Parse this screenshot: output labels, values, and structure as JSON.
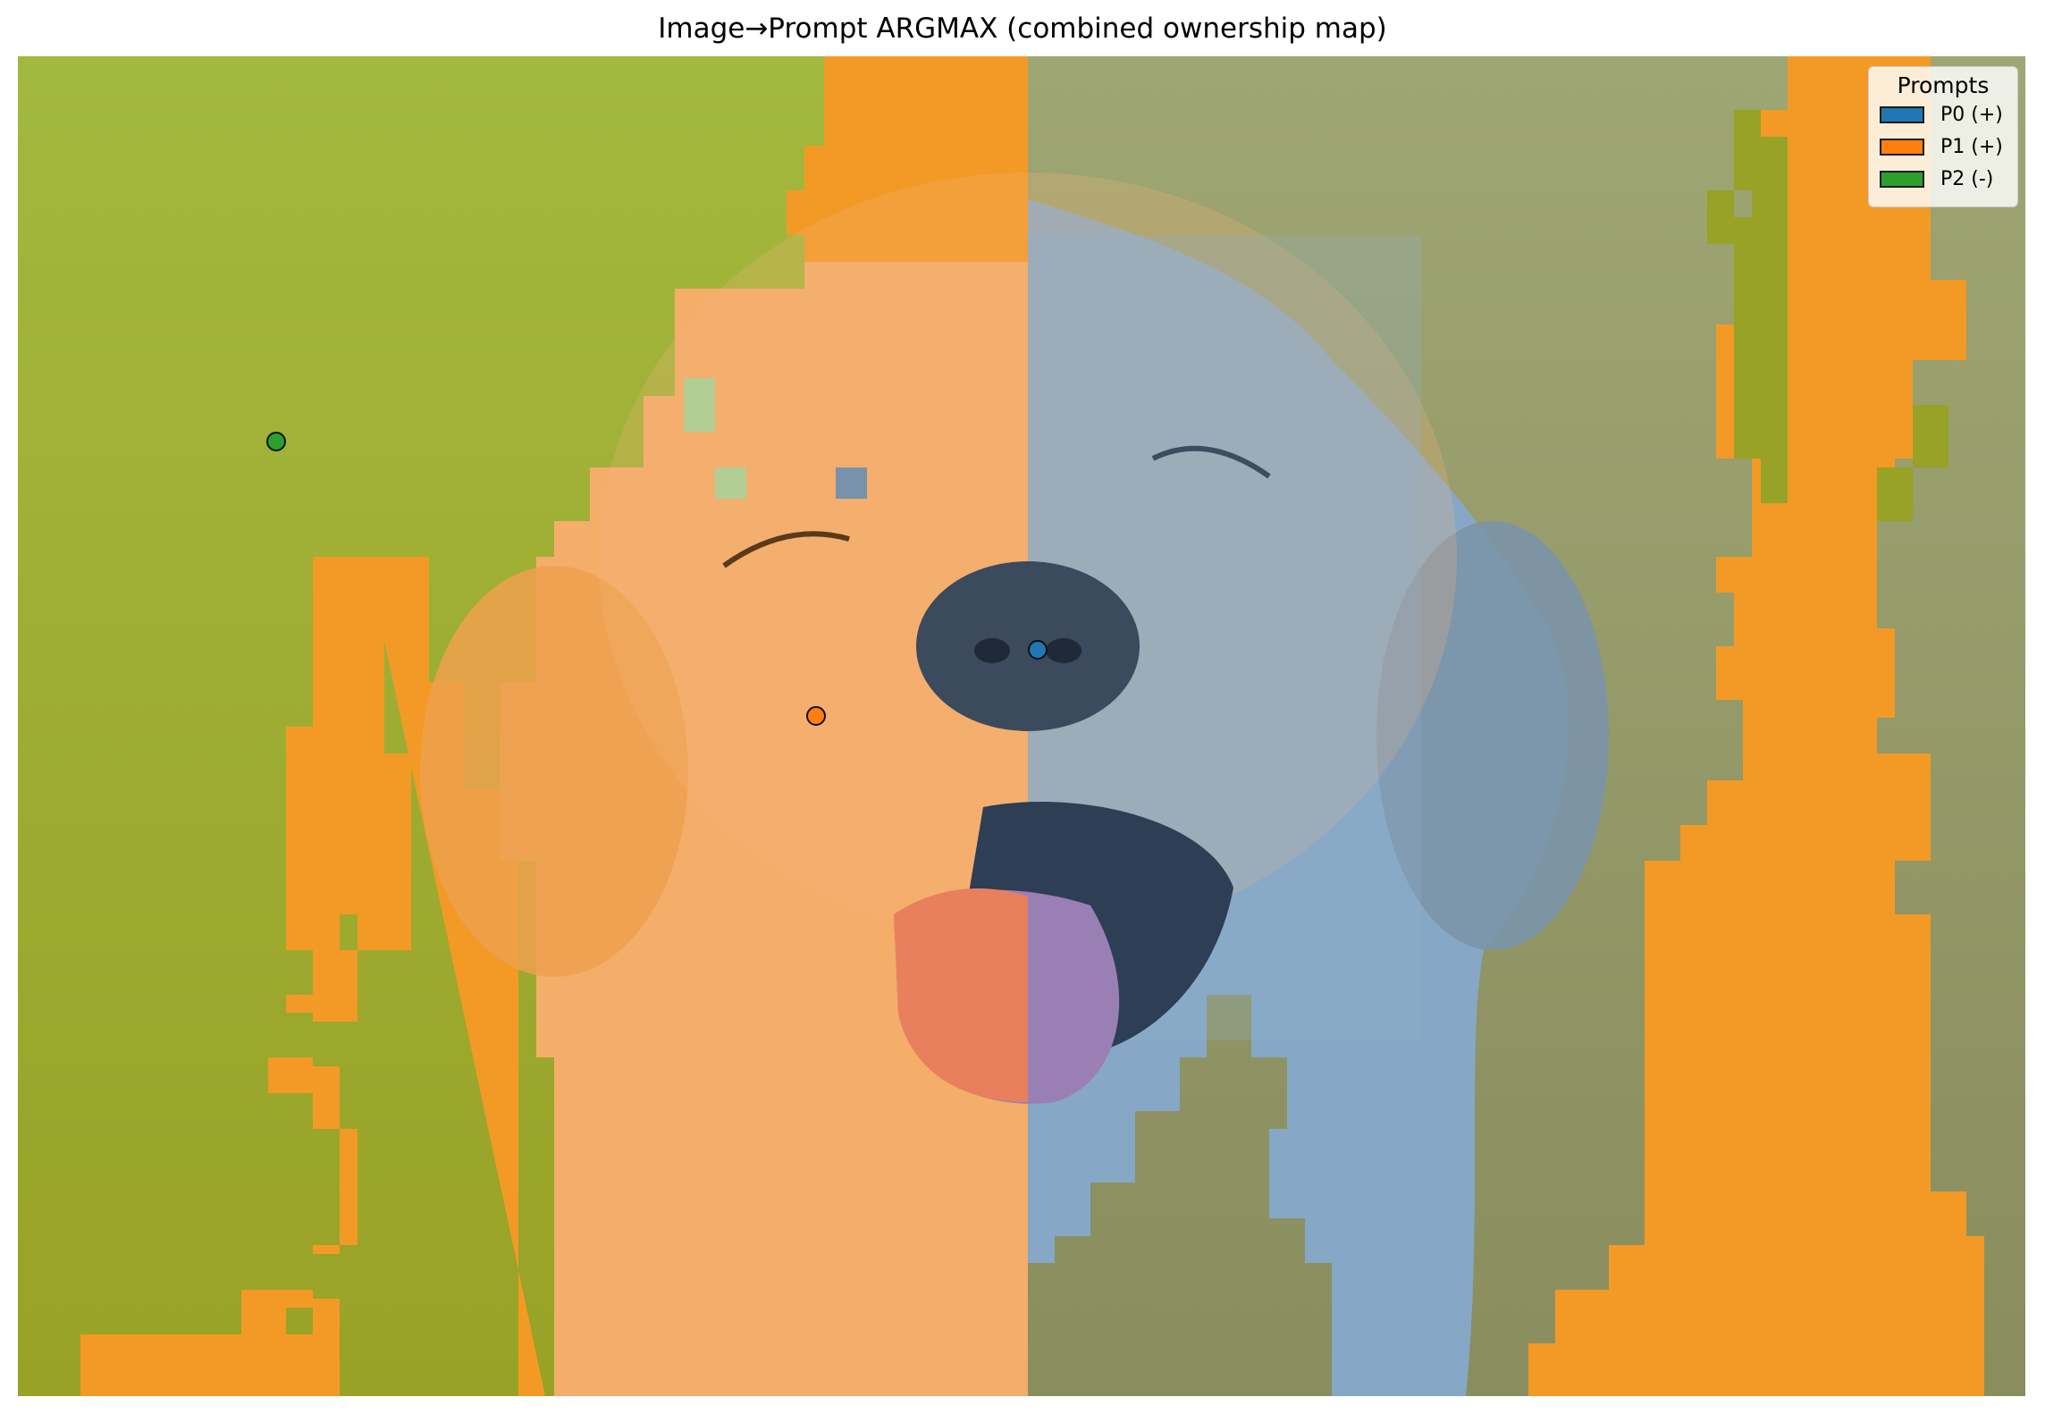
{
  "title": "Image→Prompt ARGMAX (combined ownership map)",
  "legend": {
    "title": "Prompts",
    "items": [
      {
        "label": "P0 (+)",
        "color": "#1f77b4"
      },
      {
        "label": "P1 (+)",
        "color": "#ff7f0e"
      },
      {
        "label": "P2 (-)",
        "color": "#2ca02c"
      }
    ]
  },
  "image": {
    "subject": "golden retriever puppy, eyes closed, tongue out",
    "background_color": "#a6b24a",
    "overlay": {
      "P0_color": "#1f77b4",
      "P1_color": "#ff7f0e",
      "P2_color": "#2ca02c"
    }
  },
  "prompt_points": [
    {
      "label": "P0",
      "color": "#1f77b4"
    },
    {
      "label": "P1",
      "color": "#ff7f0e"
    },
    {
      "label": "P2",
      "color": "#2ca02c"
    }
  ]
}
